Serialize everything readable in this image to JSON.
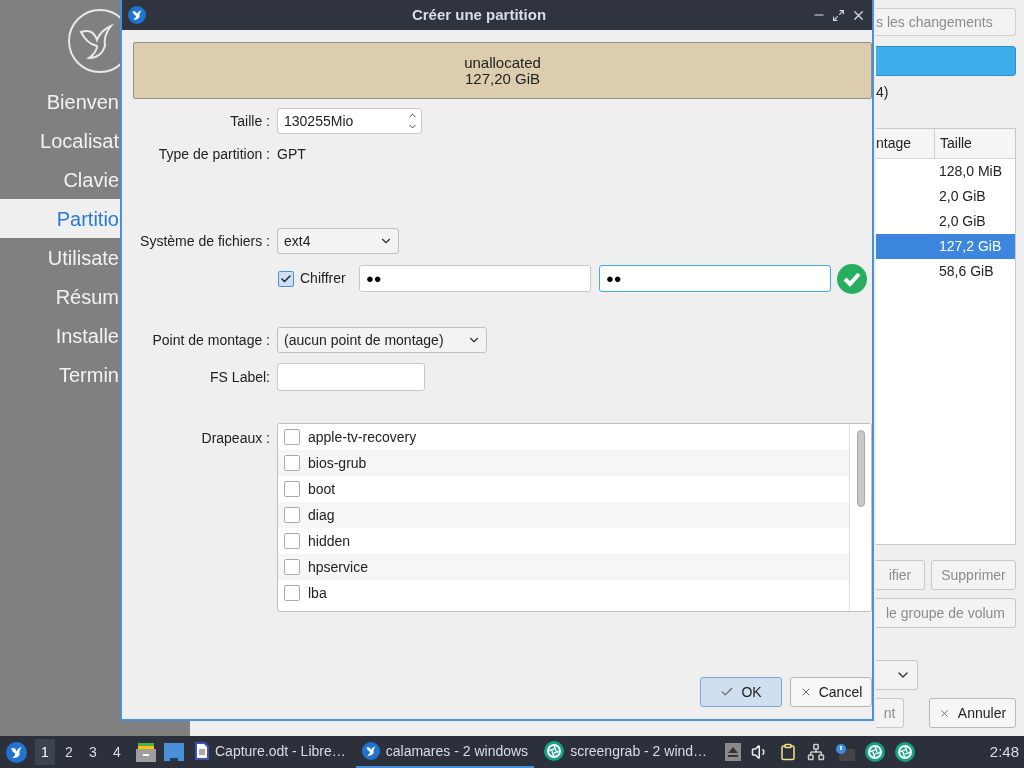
{
  "sidebar": {
    "items": [
      {
        "label": "Bienven",
        "selected": false
      },
      {
        "label": "Localisat",
        "selected": false
      },
      {
        "label": "Clavie",
        "selected": false
      },
      {
        "label": "Partitio",
        "selected": true
      },
      {
        "label": "Utilisate",
        "selected": false
      },
      {
        "label": "Résum",
        "selected": false
      },
      {
        "label": "Installe",
        "selected": false
      },
      {
        "label": "Termin",
        "selected": false
      }
    ]
  },
  "main": {
    "revert_button": "s les changements",
    "device_text": "4)",
    "table": {
      "columns": [
        "ntage",
        "Taille"
      ],
      "rows": [
        {
          "cells": [
            "",
            "128,0 MiB"
          ],
          "selected": false
        },
        {
          "cells": [
            "",
            "2,0 GiB"
          ],
          "selected": false
        },
        {
          "cells": [
            "",
            "2,0 GiB"
          ],
          "selected": false
        },
        {
          "cells": [
            "",
            "127,2 GiB"
          ],
          "selected": true
        },
        {
          "cells": [
            "",
            "58,6 GiB"
          ],
          "selected": false
        }
      ]
    },
    "row_buttons": [
      {
        "label": "ifier",
        "disabled": true
      },
      {
        "label": "Supprimer",
        "disabled": true
      }
    ],
    "volume_group_button": {
      "label": "le groupe de volum",
      "disabled": true
    },
    "bottom_buttons": [
      {
        "label": "nt",
        "disabled": true
      },
      {
        "label": "Annuler",
        "disabled": false
      }
    ]
  },
  "dialog": {
    "title": "Créer une partition",
    "partition_block": {
      "label": "unallocated",
      "size": "127,20 GiB"
    },
    "size": {
      "label": "Taille :",
      "value": "130255Mio"
    },
    "partition_type": {
      "label": "Type de partition :",
      "value": "GPT"
    },
    "filesystem": {
      "label": "Système de fichiers :",
      "value": "ext4"
    },
    "encrypt": {
      "label": "Chiffrer",
      "checked": true,
      "match": true,
      "fields": [
        {
          "value": "●●",
          "focused": false
        },
        {
          "value": "●●",
          "focused": true
        }
      ]
    },
    "mount_point": {
      "label": "Point de montage :",
      "value": "(aucun point de montage)"
    },
    "fs_label": {
      "label": "FS Label:"
    },
    "flags": {
      "label": "Drapeaux :",
      "items": [
        {
          "label": "apple-tv-recovery",
          "checked": false
        },
        {
          "label": "bios-grub",
          "checked": false
        },
        {
          "label": "boot",
          "checked": false
        },
        {
          "label": "diag",
          "checked": false
        },
        {
          "label": "hidden",
          "checked": false
        },
        {
          "label": "hpservice",
          "checked": false
        },
        {
          "label": "lba",
          "checked": false
        }
      ]
    },
    "buttons": [
      {
        "label": "OK",
        "kind": "ok",
        "default": true
      },
      {
        "label": "Cancel",
        "kind": "cancel",
        "default": false
      }
    ]
  },
  "taskbar": {
    "workspaces": [
      {
        "label": "1",
        "selected": true
      },
      {
        "label": "2",
        "selected": false
      },
      {
        "label": "3",
        "selected": false
      },
      {
        "label": "4",
        "selected": false
      }
    ],
    "tasks": [
      {
        "label": "Capture.odt - Libre…",
        "kind": "document",
        "active": false
      },
      {
        "label": "calamares - 2 windows",
        "kind": "calamares",
        "active": true
      },
      {
        "label": "screengrab - 2 wind…",
        "kind": "screengrab",
        "active": false
      }
    ],
    "clock": "2:48"
  }
}
